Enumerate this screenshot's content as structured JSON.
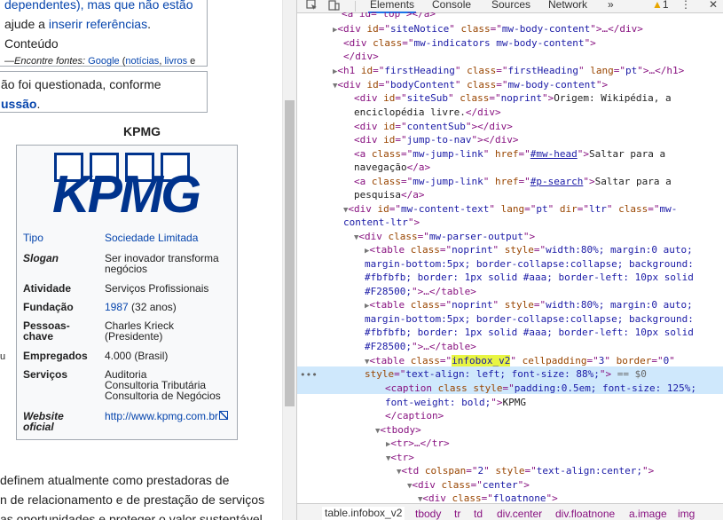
{
  "wiki": {
    "notice1": {
      "line1_plain": "dependentes), mas que não estão",
      "line2_pre": "ajude a ",
      "line2_link": "inserir referências",
      "line2_post": ". Conteúdo",
      "line3_pre": "—Encontre fontes: ",
      "line3_link1": "Google",
      "line3_mid": " (",
      "line3_link2": "notícias",
      "line3_sep": ", ",
      "line3_link3": "livros",
      "line3_post": " e"
    },
    "notice2": {
      "line1": "ão foi questionada, conforme",
      "line2_link": "ussão",
      "line2_post": "."
    },
    "infobox": {
      "caption": "KPMG",
      "logo_text": "KPMG",
      "logo_color": "#00338d",
      "rows": [
        {
          "key": "Tipo",
          "value": "Sociedade Limitada"
        },
        {
          "key": "Slogan",
          "value": "Ser inovador transforma negócios"
        },
        {
          "key": "Atividade",
          "value": "Serviços Profissionais"
        },
        {
          "key": "Fundação",
          "value_link": "1987",
          "value_post": " (32 anos)"
        },
        {
          "key": "Pessoas-chave",
          "key_line1": "Pessoas-",
          "key_line2": "chave",
          "value": "Charles Krieck (Presidente)"
        },
        {
          "key": "Empregados",
          "value": "4.000 (Brasil)"
        },
        {
          "key": "Serviços",
          "values": [
            "Auditoria",
            "Consultoria Tributária",
            "Consultoria de Negócios"
          ]
        },
        {
          "key": "Website oficial",
          "key_line1": "Website",
          "key_line2": "oficial",
          "value": "http://www.kpmg.com.br"
        }
      ]
    },
    "marker": "u",
    "body": [
      "definem atualmente como prestadoras de",
      "n de relacionamento e de prestação de serviços",
      "as oportunidades e proteger o valor sustentável"
    ]
  },
  "devtools": {
    "tabs": [
      "Elements",
      "Console",
      "Sources",
      "Network"
    ],
    "active_tab": "Elements",
    "more": "»",
    "warning_count": "1",
    "accent": "#1a73e8",
    "selected_bg": "#cfe8fc",
    "tree": {
      "l0": "<a id=\"top\"></a>",
      "l1_id": "siteNotice",
      "l1_class": "mw-body-content",
      "l2_class": "mw-indicators mw-body-content",
      "l3": "</div>",
      "l4_id": "firstHeading",
      "l4_class": "firstHeading",
      "l4_lang": "pt",
      "l5_id": "bodyContent",
      "l5_class": "mw-body-content",
      "l6_id": "siteSub",
      "l6_class": "noprint",
      "l6_text": "Origem: Wikipédia, a",
      "l7_text": "enciclopédia livre.",
      "l8_id": "contentSub",
      "l9_id": "jump-to-nav",
      "l10_class": "mw-jump-link",
      "l10_href": "#mw-head",
      "l10_text": "Saltar para a",
      "l11_text": "navegação",
      "l12_class": "mw-jump-link",
      "l12_href": "#p-search",
      "l12_text": "Saltar para a",
      "l13_text": "pesquisa",
      "l14_id": "mw-content-text",
      "l14_lang": "pt",
      "l14_dir": "ltr",
      "l14_class": "mw-",
      "l15_cont": "content-ltr",
      "l16_class": "mw-parser-output",
      "tbl_class": "noprint",
      "tbl_style1": "width:80%; margin:0 auto;",
      "tbl_style2": "margin-bottom:5px; border-collapse:collapse; background:",
      "tbl_style3": "#fbfbfb; border: 1px solid #aaa; border-left: 10px solid",
      "tbl_style4": "#F28500;",
      "sel_class": "infobox_v2",
      "sel_cellpadding": "3",
      "sel_border": "0",
      "sel_style": "text-align: left; font-size: 88%;",
      "sel_eq": " == $0",
      "cap_style1": "padding:0.5em; font-size: 125%;",
      "cap_style2": "font-weight: bold;",
      "cap_text": "KPMG",
      "td_colspan": "2",
      "td_style": "text-align:center;",
      "div_center": "center",
      "div_float": "floatnone"
    },
    "breadcrumbs": [
      "table.infobox_v2",
      "tbody",
      "tr",
      "td",
      "div.center",
      "div.floatnone",
      "a.image",
      "img"
    ]
  }
}
